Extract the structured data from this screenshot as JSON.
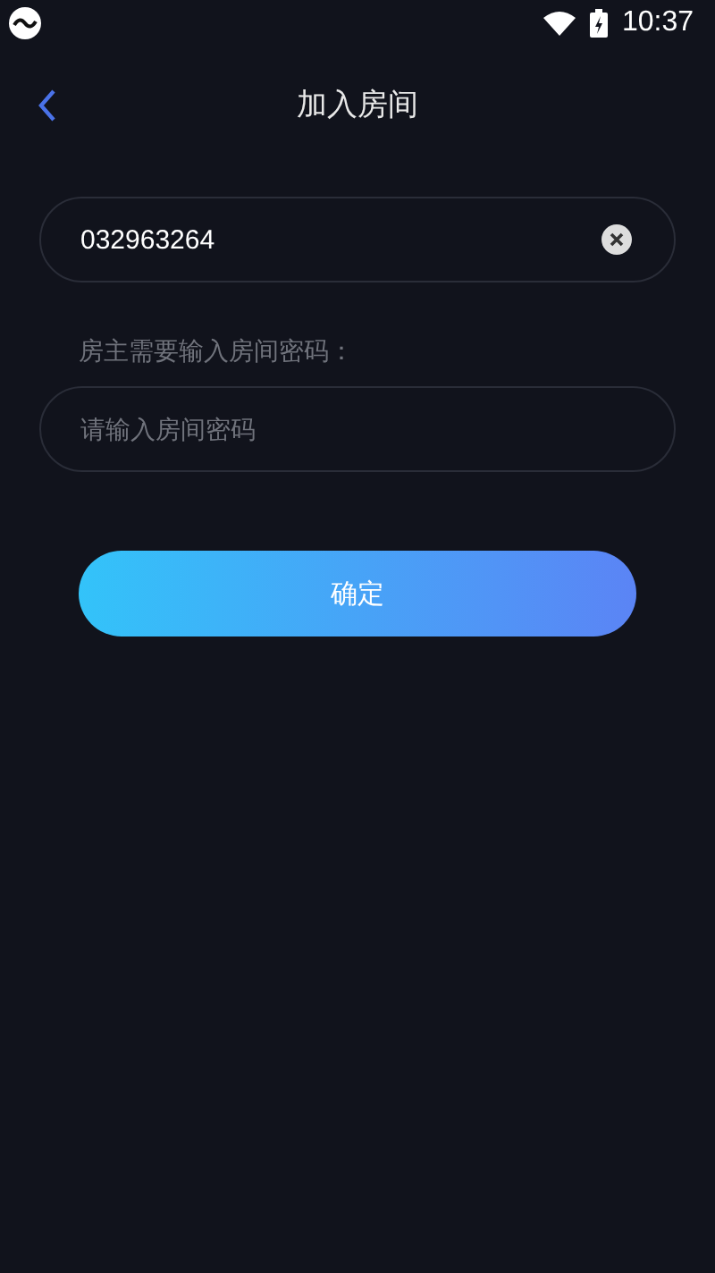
{
  "status_bar": {
    "time": "10:37"
  },
  "header": {
    "title": "加入房间"
  },
  "room_field": {
    "value": "032963264"
  },
  "password_label": "房主需要输入房间密码：",
  "password_field": {
    "placeholder": "请输入房间密码"
  },
  "confirm_button": {
    "label": "确定"
  }
}
